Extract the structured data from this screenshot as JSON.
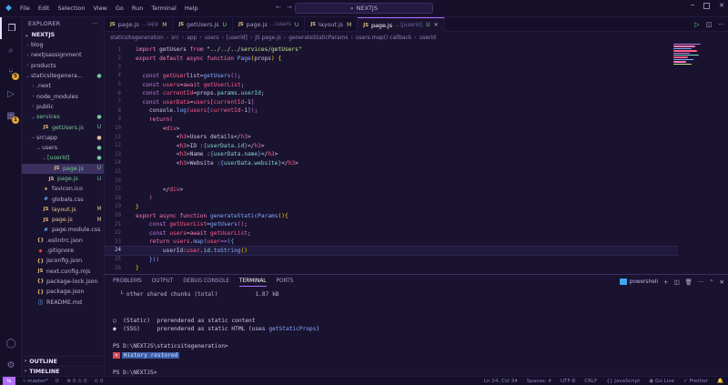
{
  "window": {
    "menu": [
      "File",
      "Edit",
      "Selection",
      "View",
      "Go",
      "Run",
      "Terminal",
      "Help"
    ],
    "search": "NEXTJS"
  },
  "sidebar": {
    "header": "EXPLORER",
    "root": "NEXTJS",
    "items": [
      {
        "label": "blog",
        "kind": "folder",
        "open": false,
        "depth": 1
      },
      {
        "label": "nextjsassignment",
        "kind": "folder",
        "open": false,
        "depth": 1
      },
      {
        "label": "products",
        "kind": "folder",
        "open": false,
        "depth": 1
      },
      {
        "label": "staticsitegenera...",
        "kind": "folder",
        "open": true,
        "depth": 1,
        "status": "dot-g"
      },
      {
        "label": ".next",
        "kind": "folder",
        "open": false,
        "depth": 2
      },
      {
        "label": "node_modules",
        "kind": "folder",
        "open": false,
        "depth": 2
      },
      {
        "label": "public",
        "kind": "folder",
        "open": false,
        "depth": 2
      },
      {
        "label": "services",
        "kind": "folder",
        "open": true,
        "depth": 2,
        "status": "dot-g",
        "color": "green"
      },
      {
        "label": "getUsers.js",
        "kind": "js",
        "depth": 3,
        "status": "U",
        "color": "green"
      },
      {
        "label": "src\\app",
        "kind": "folder",
        "open": true,
        "depth": 2,
        "status": "dot-y"
      },
      {
        "label": "users",
        "kind": "folder",
        "open": true,
        "depth": 3,
        "status": "dot-g"
      },
      {
        "label": "[userId]",
        "kind": "folder",
        "open": true,
        "depth": 4,
        "status": "dot-g",
        "color": "green"
      },
      {
        "label": "page.js",
        "kind": "js",
        "depth": 5,
        "status": "U",
        "color": "green",
        "selected": true
      },
      {
        "label": "page.js",
        "kind": "js",
        "depth": 4,
        "status": "U",
        "color": "green"
      },
      {
        "label": "favicon.ico",
        "kind": "star",
        "depth": 3
      },
      {
        "label": "globals.css",
        "kind": "css",
        "depth": 3
      },
      {
        "label": "layout.js",
        "kind": "js",
        "depth": 3,
        "status": "M",
        "color": "yellow"
      },
      {
        "label": "page.js",
        "kind": "js",
        "depth": 3,
        "status": "M",
        "color": "yellow"
      },
      {
        "label": "page.module.css",
        "kind": "css",
        "depth": 3
      },
      {
        "label": ".eslintrc.json",
        "kind": "json",
        "depth": 2
      },
      {
        "label": ".gitignore",
        "kind": "git",
        "depth": 2
      },
      {
        "label": "jsconfig.json",
        "kind": "json",
        "depth": 2
      },
      {
        "label": "next.config.mjs",
        "kind": "js",
        "depth": 2
      },
      {
        "label": "package-lock.json",
        "kind": "json",
        "depth": 2
      },
      {
        "label": "package.json",
        "kind": "json",
        "depth": 2
      },
      {
        "label": "README.md",
        "kind": "md",
        "depth": 2
      }
    ],
    "outline": "OUTLINE",
    "timeline": "TIMELINE"
  },
  "tabs": [
    {
      "name": "page.js",
      "path": "...\\app",
      "status": "M",
      "active": false
    },
    {
      "name": "getUsers.js",
      "path": "",
      "status": "U",
      "active": false
    },
    {
      "name": "page.js",
      "path": "...\\users",
      "status": "U",
      "active": false
    },
    {
      "name": "layout.js",
      "path": "",
      "status": "M",
      "active": false
    },
    {
      "name": "page.js",
      "path": "...\\[userId]",
      "status": "U",
      "active": true
    }
  ],
  "breadcrumb": [
    "staticsitegeneration",
    "src",
    "app",
    "users",
    "[userId]",
    "JS page.js",
    "generateStaticParams",
    "users.map() callback",
    "userId"
  ],
  "editor": {
    "lines": [
      {
        "n": "1",
        "html": "<span class='kw2'>import</span> <span class='plain'>getUsers</span> <span class='kw2'>from</span> <span class='str'>\"../../../services/getUsers\"</span>"
      },
      {
        "n": "2",
        "html": "<span class='kw2'>export default async function</span> <span class='fn'>Page</span><span class='br'>(</span><span class='plain'>props</span><span class='br'>)</span> <span class='br'>{</span>"
      },
      {
        "n": "3",
        "html": ""
      },
      {
        "n": "4",
        "html": "  <span class='kw'>const</span> <span class='var'>getUser</span><span class='plain'>list=</span><span class='fn'>getUsers</span><span class='brc'>()</span><span class='plain'>;</span>"
      },
      {
        "n": "5",
        "html": "  <span class='kw'>const</span> <span class='var'>users</span><span class='plain'>=</span><span class='kw2'>await</span> <span class='var'>getUserList</span><span class='plain'>;</span>"
      },
      {
        "n": "6",
        "html": "  <span class='kw'>const</span> <span class='var'>currentId</span><span class='plain'>=props.</span><span class='prop'>params</span><span class='plain'>.</span><span class='prop'>userId</span><span class='plain'>;</span>"
      },
      {
        "n": "7",
        "html": "  <span class='kw'>const</span> <span class='var'>userData</span><span class='plain'>=</span><span class='var'>users</span><span class='brc'>[</span><span class='var'>currentId</span><span class='plain'>-1</span><span class='brc'>]</span>"
      },
      {
        "n": "8",
        "html": "    <span class='plain'>console.</span><span class='fn'>log</span><span class='brc'>(</span><span class='var'>users</span><span class='fn'>[</span><span class='var'>currentId</span><span class='plain'>-1</span><span class='fn'>]</span><span class='brc'>)</span><span class='plain'>;</span>"
      },
      {
        "n": "9",
        "html": "    <span class='kw2'>return</span><span class='brc'>(</span>"
      },
      {
        "n": "10",
        "html": "        <span class='plain'>&lt;</span><span class='tag'>div</span><span class='plain'>&gt;</span>"
      },
      {
        "n": "11",
        "html": "            <span class='plain'>&lt;</span><span class='tag'>h3</span><span class='plain'>&gt;Users details&lt;/</span><span class='tag'>h3</span><span class='plain'>&gt;</span>"
      },
      {
        "n": "12",
        "html": "            <span class='plain'>&lt;</span><span class='tag'>h3</span><span class='plain'>&gt;ID :</span><span class='fn'>{</span><span class='prop'>userData.id</span><span class='fn'>}</span><span class='plain'>&lt;/</span><span class='tag'>h3</span><span class='plain'>&gt;</span>"
      },
      {
        "n": "13",
        "html": "            <span class='plain'>&lt;</span><span class='tag'>h3</span><span class='plain'>&gt;Name :</span><span class='fn'>{</span><span class='prop'>userData.name</span><span class='fn'>}</span><span class='plain'>&lt;/</span><span class='tag'>h3</span><span class='plain'>&gt;</span>"
      },
      {
        "n": "14",
        "html": "            <span class='plain'>&lt;</span><span class='tag'>h3</span><span class='plain'>&gt;Website :</span><span class='fn'>{</span><span class='prop'>userData.website</span><span class='fn'>}</span><span class='plain'>&lt;/</span><span class='tag'>h3</span><span class='plain'>&gt;</span>"
      },
      {
        "n": "15",
        "html": ""
      },
      {
        "n": "16",
        "html": ""
      },
      {
        "n": "17",
        "html": "        <span class='plain'>&lt;/</span><span class='tag'>div</span><span class='plain'>&gt;</span>"
      },
      {
        "n": "18",
        "html": "    <span class='brc'>)</span>"
      },
      {
        "n": "19",
        "html": "<span class='br'>}</span>"
      },
      {
        "n": "20",
        "html": "<span class='kw2'>export async function</span> <span class='fn'>generateStaticParams</span><span class='br'>()</span><span class='br'>{</span>"
      },
      {
        "n": "21",
        "html": "    <span class='kw'>const</span> <span class='var'>getUserList</span><span class='plain'>=</span><span class='fn'>getUsers</span><span class='brc'>()</span><span class='plain'>;</span>"
      },
      {
        "n": "22",
        "html": "    <span class='kw'>const</span> <span class='var'>users</span><span class='plain'>=</span><span class='kw2'>await</span> <span class='var'>getUserList</span><span class='plain'>;</span>"
      },
      {
        "n": "23",
        "html": "    <span class='kw2'>return</span> <span class='var'>users</span><span class='plain'>.</span><span class='fn'>map</span><span class='brc'>(</span><span class='var'>user</span><span class='kw'>=&gt;</span><span class='fn'>({</span>"
      },
      {
        "n": "24",
        "html": "        <span class='plain'>userId:</span><span class='var'>user</span><span class='plain'>.</span><span class='prop'>id</span><span class='plain'>.</span><span class='fn'>toString</span><span class='br'>()</span>"
      },
      {
        "n": "25",
        "html": "    <span class='fn'>})</span><span class='brc'>)</span>"
      },
      {
        "n": "26",
        "html": "<span class='br'>}</span>"
      }
    ],
    "cursor_line": "24"
  },
  "panel": {
    "tabs": [
      "PROBLEMS",
      "OUTPUT",
      "DEBUG CONSOLE",
      "TERMINAL",
      "PORTS"
    ],
    "active_tab": "TERMINAL",
    "shell": "powershell",
    "lines": {
      "chunks": "  └ other shared chunks (total)           1.87 kB",
      "static": "○  (Static)  prerendered as static content",
      "ssg": "●  (SSG)     prerendered as static HTML (uses ",
      "ssg_fn": "getStaticProps",
      "ssg_end": ")",
      "prompt1": "PS D:\\NEXTJS\\staticsitegeneration>",
      "restored": "History restored",
      "prompt2": "PS D:\\NEXTJS>"
    }
  },
  "statusbar": {
    "branch": "master*",
    "errors": "0",
    "warnings": "0",
    "ports": "0",
    "position": "Ln 24, Col 34",
    "spaces": "Spaces: 4",
    "encoding": "UTF-8",
    "eol": "CRLF",
    "language": "JavaScript",
    "golive": "Go Live",
    "prettier": "Prettier"
  }
}
